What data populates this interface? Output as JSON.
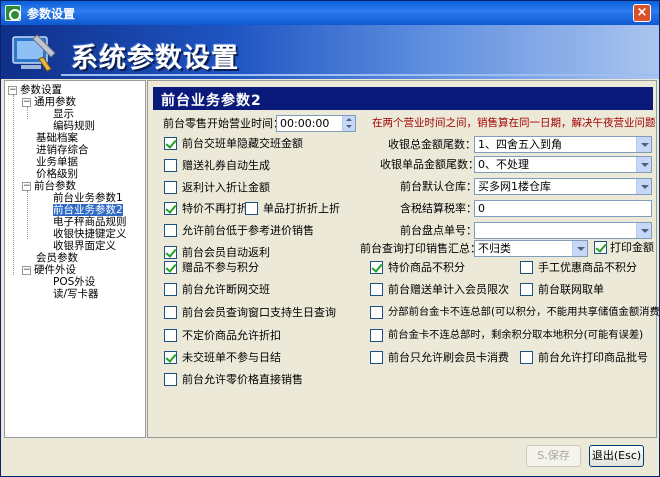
{
  "window": {
    "title": "参数设置",
    "close": "×"
  },
  "banner": {
    "title": "系统参数设置"
  },
  "tree": {
    "nodes": [
      {
        "label": "参数设置",
        "toggle": "⊟"
      },
      {
        "label": "通用参数",
        "toggle": "⊟"
      },
      {
        "label": "显示"
      },
      {
        "label": "编码规则"
      },
      {
        "label": "基础档案"
      },
      {
        "label": "进销存综合"
      },
      {
        "label": "业务单据"
      },
      {
        "label": "价格级别"
      },
      {
        "label": "前台参数",
        "toggle": "⊟"
      },
      {
        "label": "前台业务参数1"
      },
      {
        "label": "前台业务参数2"
      },
      {
        "label": "电子秤商品规则"
      },
      {
        "label": "收银快捷键定义"
      },
      {
        "label": "收银界面定义"
      },
      {
        "label": "会员参数"
      },
      {
        "label": "硬件外设",
        "toggle": "⊟"
      },
      {
        "label": "POS外设"
      },
      {
        "label": "读/写卡器"
      }
    ]
  },
  "panel": {
    "title": "前台业务参数2",
    "start_time_label": "前台零售开始营业时间：",
    "start_time_value": "00:00:00",
    "note": "在两个营业时间之间，销售算在同一日期，解决午夜营业问题",
    "left_checks": [
      {
        "label": "前台交班单隐藏交班金额",
        "checked": true
      },
      {
        "label": "赠送礼券自动生成",
        "checked": false
      },
      {
        "label": "返利计入折让金额",
        "checked": false
      },
      {
        "label": "特价不再打折",
        "checked": true
      },
      {
        "label": "单品打折折上折",
        "checked": false
      },
      {
        "label": "允许前台低于参考进价销售",
        "checked": false
      },
      {
        "label": "前台会员自动返利",
        "checked": true
      }
    ],
    "fields": {
      "total_round_label": "收银总金额尾数：",
      "total_round_value": "1、四舍五入到角",
      "item_round_label": "收银单品金额尾数：",
      "item_round_value": "0、不处理",
      "warehouse_label": "前台默认仓库：",
      "warehouse_value": "买多网1楼仓库",
      "tax_label": "含税结算税率：",
      "tax_value": "0",
      "stock_label": "前台盘点单号：",
      "stock_value": "",
      "print_summary_label": "前台查询打印销售汇总：",
      "print_summary_value": "不归类",
      "print_amount_label": "打印金额"
    },
    "grid_checks": [
      {
        "label": "赠品不参与积分",
        "checked": true
      },
      {
        "label": "特价商品不积分",
        "checked": true
      },
      {
        "label": "手工优惠商品不积分",
        "checked": false
      },
      {
        "label": "前台允许断网交班",
        "checked": false
      },
      {
        "label": "前台赠送单计入会员限次",
        "checked": false
      },
      {
        "label": "前台联网取单",
        "checked": false
      },
      {
        "label": "前台会员查询窗口支持生日查询",
        "checked": false
      },
      {
        "label": "分部前台金卡不连总部(可以积分，不能用共享储值金额消费)",
        "checked": false
      },
      {
        "label": "不定价商品允许折扣",
        "checked": false
      },
      {
        "label": "前台金卡不连总部时，剩余积分取本地积分(可能有误差)",
        "checked": false
      },
      {
        "label": "未交班单不参与日结",
        "checked": true
      },
      {
        "label": "前台只允许刷会员卡消费",
        "checked": false
      },
      {
        "label": "前台允许打印商品批号",
        "checked": false
      },
      {
        "label": "前台允许零价格直接销售",
        "checked": false
      }
    ],
    "print_amount_checked": true
  },
  "buttons": {
    "save": "S.保存",
    "exit": "退出(Esc)"
  },
  "colors": {
    "accent": "#0a1a7a",
    "selection": "#316ac5",
    "note": "#a00000"
  }
}
